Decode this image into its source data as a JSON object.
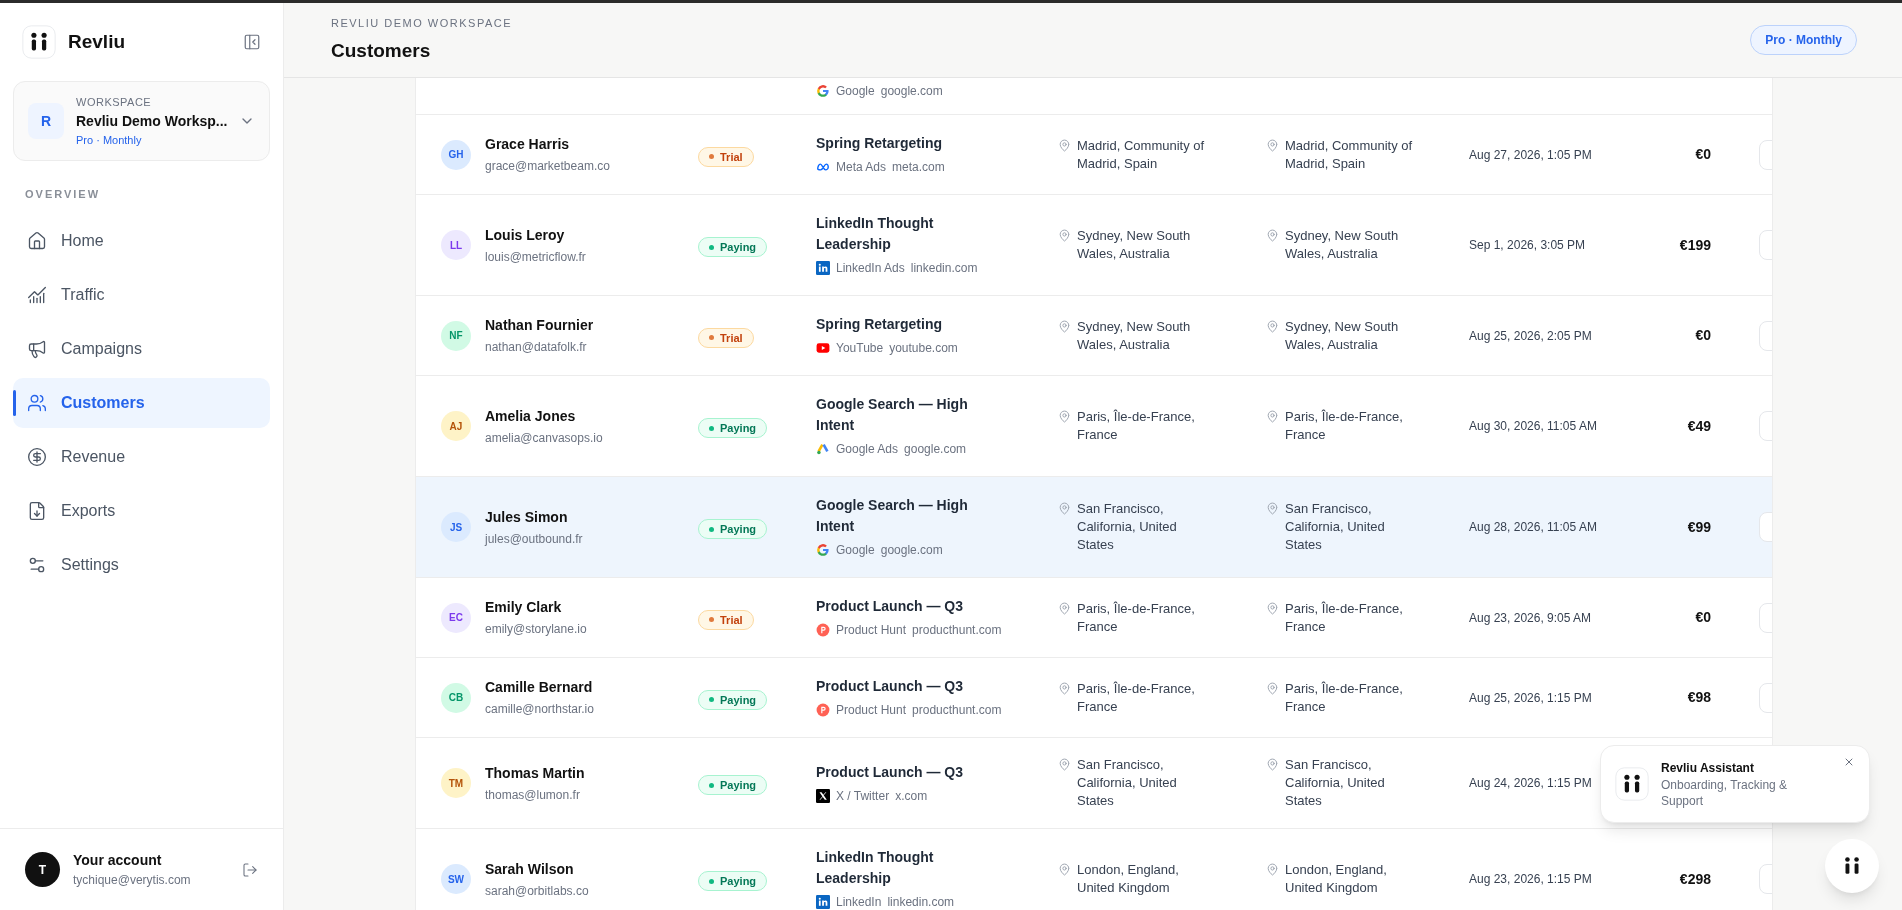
{
  "sidebar": {
    "brand": "Revliu",
    "workspace": {
      "initial": "R",
      "label": "WORKSPACE",
      "name": "Revliu Demo Worksp...",
      "plan": "Pro · Monthly"
    },
    "section": "OVERVIEW",
    "items": [
      {
        "label": "Home",
        "selected": false
      },
      {
        "label": "Traffic",
        "selected": false
      },
      {
        "label": "Campaigns",
        "selected": false
      },
      {
        "label": "Customers",
        "selected": true
      },
      {
        "label": "Revenue",
        "selected": false
      },
      {
        "label": "Exports",
        "selected": false
      },
      {
        "label": "Settings",
        "selected": false
      }
    ],
    "account": {
      "initial": "T",
      "title": "Your account",
      "email": "tychique@verytis.com"
    }
  },
  "header": {
    "workspace": "REVLIU DEMO WORKSPACE",
    "title": "Customers",
    "plan_badge": "Pro · Monthly"
  },
  "partial_row": {
    "source": {
      "kind": "google",
      "platform": "Google",
      "domain": "google.com"
    }
  },
  "rows": [
    {
      "initials": "GH",
      "color": "#dbeafe",
      "name": "Grace Harris",
      "email": "grace@marketbeam.co",
      "status": {
        "kind": "trial",
        "label": "Trial"
      },
      "campaign": "Spring Retargeting",
      "source": {
        "kind": "meta",
        "platform": "Meta Ads",
        "domain": "meta.com"
      },
      "location_1": "Madrid, Community of Madrid, Spain",
      "location_2": "Madrid, Community of Madrid, Spain",
      "date": "Aug 27, 2026, 1:05 PM",
      "amount": "€0",
      "selected": false
    },
    {
      "initials": "LL",
      "color": "#ede9fe",
      "name": "Louis Leroy",
      "email": "louis@metricflow.fr",
      "status": {
        "kind": "paying",
        "label": "Paying"
      },
      "campaign": "LinkedIn Thought Leadership",
      "source": {
        "kind": "linkedin",
        "platform": "LinkedIn Ads",
        "domain": "linkedin.com"
      },
      "location_1": "Sydney, New South Wales, Australia",
      "location_2": "Sydney, New South Wales, Australia",
      "date": "Sep 1, 2026, 3:05 PM",
      "amount": "€199",
      "selected": false
    },
    {
      "initials": "NF",
      "color": "#d1fae5",
      "name": "Nathan Fournier",
      "email": "nathan@datafolk.fr",
      "status": {
        "kind": "trial",
        "label": "Trial"
      },
      "campaign": "Spring Retargeting",
      "source": {
        "kind": "youtube",
        "platform": "YouTube",
        "domain": "youtube.com"
      },
      "location_1": "Sydney, New South Wales, Australia",
      "location_2": "Sydney, New South Wales, Australia",
      "date": "Aug 25, 2026, 2:05 PM",
      "amount": "€0",
      "selected": false
    },
    {
      "initials": "AJ",
      "color": "#fef3c7",
      "name": "Amelia Jones",
      "email": "amelia@canvasops.io",
      "status": {
        "kind": "paying",
        "label": "Paying"
      },
      "campaign": "Google Search — High Intent",
      "source": {
        "kind": "google-ads",
        "platform": "Google Ads",
        "domain": "google.com"
      },
      "location_1": "Paris, Île-de-France, France",
      "location_2": "Paris, Île-de-France, France",
      "date": "Aug 30, 2026, 11:05 AM",
      "amount": "€49",
      "selected": false
    },
    {
      "initials": "JS",
      "color": "#dbeafe",
      "name": "Jules Simon",
      "email": "jules@outbound.fr",
      "status": {
        "kind": "paying",
        "label": "Paying"
      },
      "campaign": "Google Search — High Intent",
      "source": {
        "kind": "google",
        "platform": "Google",
        "domain": "google.com"
      },
      "location_1": "San Francisco, California, United States",
      "location_2": "San Francisco, California, United States",
      "date": "Aug 28, 2026, 11:05 AM",
      "amount": "€99",
      "selected": true
    },
    {
      "initials": "EC",
      "color": "#ede9fe",
      "name": "Emily Clark",
      "email": "emily@storylane.io",
      "status": {
        "kind": "trial",
        "label": "Trial"
      },
      "campaign": "Product Launch — Q3",
      "source": {
        "kind": "producthunt",
        "platform": "Product Hunt",
        "domain": "producthunt.com"
      },
      "location_1": "Paris, Île-de-France, France",
      "location_2": "Paris, Île-de-France, France",
      "date": "Aug 23, 2026, 9:05 AM",
      "amount": "€0",
      "selected": false
    },
    {
      "initials": "CB",
      "color": "#d1fae5",
      "name": "Camille Bernard",
      "email": "camille@northstar.io",
      "status": {
        "kind": "paying",
        "label": "Paying"
      },
      "campaign": "Product Launch — Q3",
      "source": {
        "kind": "producthunt",
        "platform": "Product Hunt",
        "domain": "producthunt.com"
      },
      "location_1": "Paris, Île-de-France, France",
      "location_2": "Paris, Île-de-France, France",
      "date": "Aug 25, 2026, 1:15 PM",
      "amount": "€98",
      "selected": false
    },
    {
      "initials": "TM",
      "color": "#fef3c7",
      "name": "Thomas Martin",
      "email": "thomas@lumon.fr",
      "status": {
        "kind": "paying",
        "label": "Paying"
      },
      "campaign": "Product Launch — Q3",
      "source": {
        "kind": "x",
        "platform": "X / Twitter",
        "domain": "x.com"
      },
      "location_1": "San Francisco, California, United States",
      "location_2": "San Francisco, California, United States",
      "date": "Aug 24, 2026, 1:15 PM",
      "selected": false
    },
    {
      "initials": "SW",
      "color": "#dbeafe",
      "name": "Sarah Wilson",
      "email": "sarah@orbitlabs.co",
      "status": {
        "kind": "paying",
        "label": "Paying"
      },
      "campaign": "LinkedIn Thought Leadership",
      "source": {
        "kind": "linkedin",
        "platform": "LinkedIn",
        "domain": "linkedin.com"
      },
      "location_1": "London, England, United Kingdom",
      "location_2": "London, England, United Kingdom",
      "date": "Aug 23, 2026, 1:15 PM",
      "amount": "€298",
      "selected": false
    }
  ],
  "assistant": {
    "title": "Revliu Assistant",
    "subtitle": "Onboarding, Tracking & Support"
  }
}
